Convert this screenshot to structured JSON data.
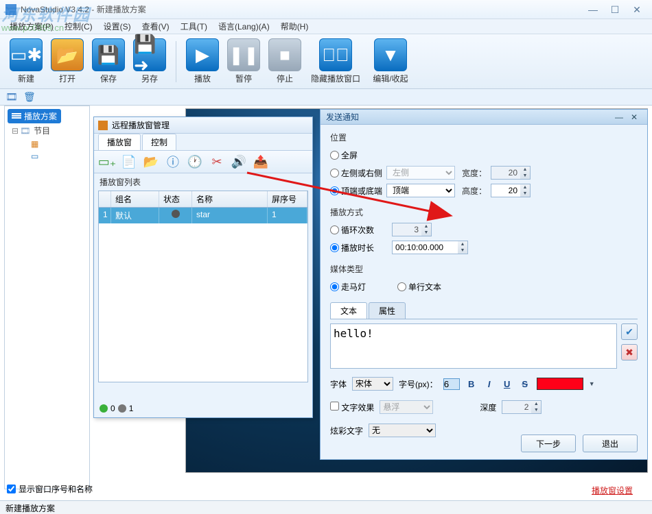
{
  "window": {
    "title": "NovaStudio V3.4.2 - 新建播放方案",
    "min": "—",
    "max": "☐",
    "close": "✕"
  },
  "watermark": {
    "line1": "河东软件园",
    "line2": "www.pc0359.cn"
  },
  "menu": {
    "items": [
      "播放方案(P)",
      "控制(C)",
      "设置(S)",
      "查看(V)",
      "工具(T)",
      "语言(Lang)(A)",
      "帮助(H)"
    ]
  },
  "toolbar": {
    "new": "新建",
    "open": "打开",
    "save": "保存",
    "saveas": "另存",
    "play": "播放",
    "pause": "暂停",
    "stop": "停止",
    "hide": "隐藏播放窗口",
    "edit": "编辑/收起"
  },
  "tree": {
    "root": "播放方案",
    "node_program": "节目",
    "bottom_check": "显示窗口序号和名称"
  },
  "remote": {
    "title": "远程播放窗管理",
    "tabs": {
      "a": "播放窗",
      "b": "控制"
    },
    "list_label": "播放窗列表",
    "cols": {
      "c0": "",
      "c1": "组名",
      "c2": "状态",
      "c3": "名称",
      "c4": "屏序号"
    },
    "row": {
      "id": "1",
      "group": "默认",
      "name": "star",
      "screen": "1"
    },
    "status": {
      "green": "0",
      "grey": "1"
    }
  },
  "notify": {
    "title": "发送通知",
    "sections": {
      "position": "位置",
      "playmode": "播放方式",
      "mediatype": "媒体类型"
    },
    "position": {
      "fullscreen": "全屏",
      "leftright": "左侧或右侧",
      "lr_sel": "左侧",
      "width_lbl": "宽度：",
      "width_val": "20",
      "topbottom": "顶端或底端",
      "tb_sel": "顶端",
      "height_lbl": "高度：",
      "height_val": "20"
    },
    "playmode": {
      "loop": "循环次数",
      "loop_val": "3",
      "duration": "播放时长",
      "duration_val": "00:10:00.000"
    },
    "mediatype": {
      "marquee": "走马灯",
      "single": "单行文本"
    },
    "text_tabs": {
      "a": "文本",
      "b": "属性"
    },
    "textarea": "hello!",
    "font": {
      "label": "字体",
      "value": "宋体",
      "size_label": "字号(px)：",
      "size_val": "6"
    },
    "effect": {
      "check_label": "文字效果",
      "value": "悬浮",
      "depth_label": "深度",
      "depth_val": "2"
    },
    "color_text": {
      "label": "炫彩文字",
      "value": "无"
    },
    "buttons": {
      "next": "下一步",
      "exit": "退出"
    }
  },
  "red_link": "播放窗设置",
  "statusbar": "新建播放方案"
}
